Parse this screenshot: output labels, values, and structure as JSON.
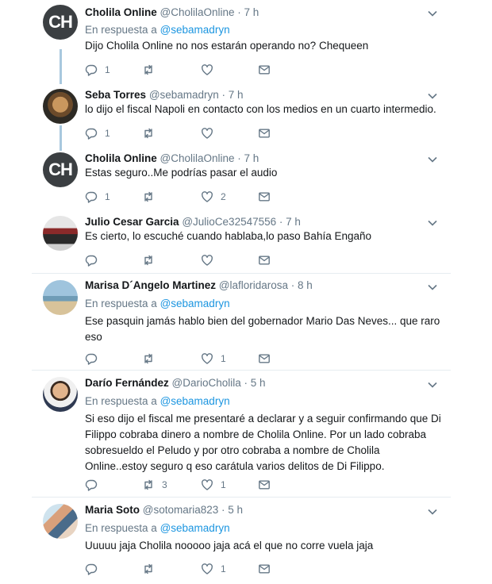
{
  "reply_prefix": "En respuesta a",
  "tweets": [
    {
      "avatar_text": "CH",
      "name": "Cholila Online",
      "meta": "@CholilaOnline · 7 h",
      "reply_to": "@sebamadryn",
      "text": "Dijo Cholila Online no nos estarán operando no? Chequeen",
      "replies": "1",
      "retweets": "",
      "likes": ""
    },
    {
      "name": "Seba Torres",
      "meta": "@sebamadryn · 7 h",
      "text": "lo dijo el fiscal Napoli en contacto con los medios en un cuarto intermedio.",
      "replies": "1",
      "retweets": "",
      "likes": ""
    },
    {
      "avatar_text": "CH",
      "name": "Cholila Online",
      "meta": "@CholilaOnline · 7 h",
      "text": "Estas seguro..Me podrías pasar el audio",
      "replies": "1",
      "retweets": "",
      "likes": "2"
    },
    {
      "name": "Julio Cesar Garcia",
      "meta": "@JulioCe32547556 · 7 h",
      "text": "Es cierto, lo escuché cuando hablaba,lo paso Bahía Engaño",
      "replies": "",
      "retweets": "",
      "likes": ""
    },
    {
      "name": "Marisa D´Angelo Martinez",
      "meta": "@lafloridarosa · 8 h",
      "reply_to": "@sebamadryn",
      "text": "Ese pasquin jamás hablo bien del gobernador Mario Das Neves... que raro eso",
      "replies": "",
      "retweets": "",
      "likes": "1"
    },
    {
      "name": "Darío Fernández",
      "meta": "@DarioCholila · 5 h",
      "reply_to": "@sebamadryn",
      "text": "Si eso dijo el fiscal me presentaré a declarar y a seguir confirmando que Di Filippo cobraba dinero a nombre de Cholila Online. Por un lado cobraba sobresueldo el Peludo y por otro cobraba a nombre de Cholila Online..estoy seguro q eso carátula varios delitos de Di Filippo.",
      "replies": "",
      "retweets": "3",
      "likes": "1"
    },
    {
      "name": "Maria Soto",
      "meta": "@sotomaria823 · 5 h",
      "reply_to": "@sebamadryn",
      "text": "Uuuuu jaja Cholila nooooo jaja acá el que no corre vuela jaja",
      "replies": "",
      "retweets": "",
      "likes": "1"
    }
  ]
}
